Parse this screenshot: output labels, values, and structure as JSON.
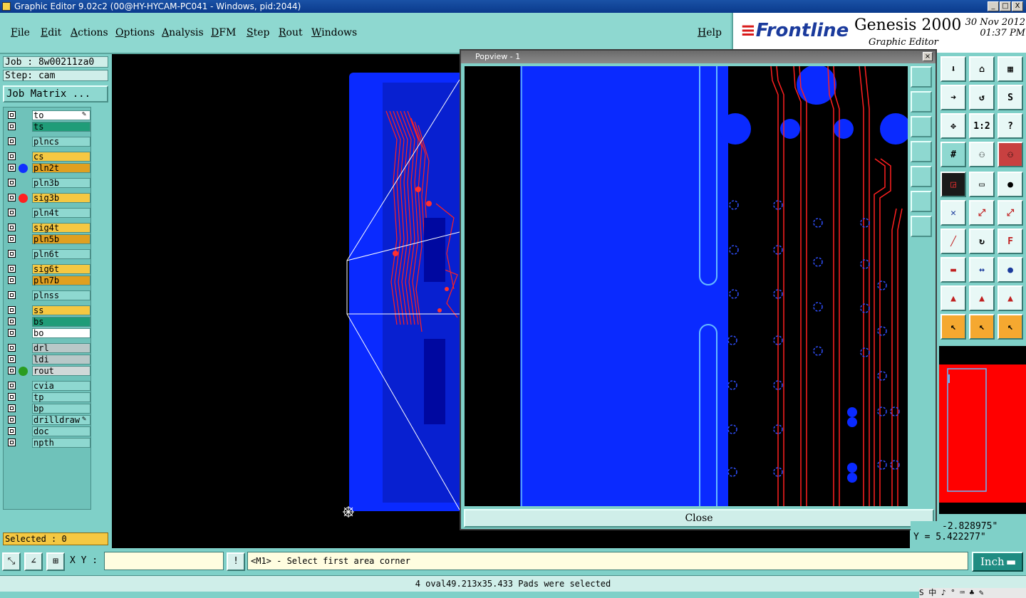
{
  "window": {
    "title": "Graphic Editor 9.02c2 (00@HY-HYCAM-PC041 - Windows, pid:2044)",
    "buttons": [
      "_",
      "□",
      "X"
    ]
  },
  "menubar": {
    "items": [
      "File",
      "Edit",
      "Actions",
      "Options",
      "Analysis",
      "DFM",
      "Step",
      "Rout",
      "Windows"
    ],
    "help": "Help"
  },
  "brand": {
    "logo": "Frontline",
    "product": "Genesis 2000",
    "subtitle": "Graphic Editor",
    "date": "30 Nov 2012",
    "time": "01:37 PM",
    "logo_color": "#1a3a9c",
    "logo_accent": "#d81818"
  },
  "left_panel": {
    "job": "Job : 8w00211za0",
    "step": "Step: cam",
    "job_matrix": "Job Matrix ...",
    "selected": "Selected : 0",
    "layers": [
      {
        "name": "to",
        "color": "#ffffff",
        "dot": "",
        "tool": "pen"
      },
      {
        "name": "ts",
        "color": "#1f9c78",
        "dot": ""
      },
      {
        "name": "plncs",
        "color": "#8ed8d0",
        "dot": ""
      },
      {
        "name": "cs",
        "color": "#f5c842",
        "dot": ""
      },
      {
        "name": "pln2t",
        "color": "#e0a020",
        "dot": "#1030ff"
      },
      {
        "name": "pln3b",
        "color": "#8ed8d0",
        "dot": ""
      },
      {
        "name": "sig3b",
        "color": "#f5c842",
        "dot": "#ff2020"
      },
      {
        "name": "pln4t",
        "color": "#8ed8d0",
        "dot": ""
      },
      {
        "name": "sig4t",
        "color": "#f5c842",
        "dot": ""
      },
      {
        "name": "pln5b",
        "color": "#e0a020",
        "dot": ""
      },
      {
        "name": "pln6t",
        "color": "#8ed8d0",
        "dot": ""
      },
      {
        "name": "sig6t",
        "color": "#f5c842",
        "dot": ""
      },
      {
        "name": "pln7b",
        "color": "#e0a020",
        "dot": ""
      },
      {
        "name": "plnss",
        "color": "#8ed8d0",
        "dot": ""
      },
      {
        "name": "ss",
        "color": "#f5c842",
        "dot": ""
      },
      {
        "name": "bs",
        "color": "#1f9c78",
        "dot": ""
      },
      {
        "name": "bo",
        "color": "#ffffff",
        "dot": ""
      },
      {
        "name": "drl",
        "color": "#b8c8c8",
        "dot": ""
      },
      {
        "name": "ldi",
        "color": "#b8c8c8",
        "dot": ""
      },
      {
        "name": "rout",
        "color": "#d0d8d8",
        "dot": "#2a9c20"
      },
      {
        "name": "cvia",
        "color": "#8ed8d0",
        "dot": ""
      },
      {
        "name": "tp",
        "color": "#8ed8d0",
        "dot": ""
      },
      {
        "name": "bp",
        "color": "#8ed8d0",
        "dot": ""
      },
      {
        "name": "drilldraw",
        "color": "#8ed8d0",
        "dot": "",
        "tool": "pen"
      },
      {
        "name": "doc",
        "color": "#8ed8d0",
        "dot": ""
      },
      {
        "name": "npth",
        "color": "#8ed8d0",
        "dot": ""
      }
    ]
  },
  "popview": {
    "title": "Popview - 1",
    "close_label": "Close"
  },
  "coords": {
    "x": "-2.828975\"",
    "y": "Y = 5.422277\""
  },
  "cmdbar": {
    "xy_label": "X Y :",
    "xy_value": "",
    "prompt": "<M1> - Select first area corner",
    "unit": "Inch"
  },
  "status": {
    "message": "4 oval49.213x35.433 Pads were selected"
  },
  "taskbar": {
    "ime": "S 中 ♪ ° ⌨ ♣ ✎"
  }
}
